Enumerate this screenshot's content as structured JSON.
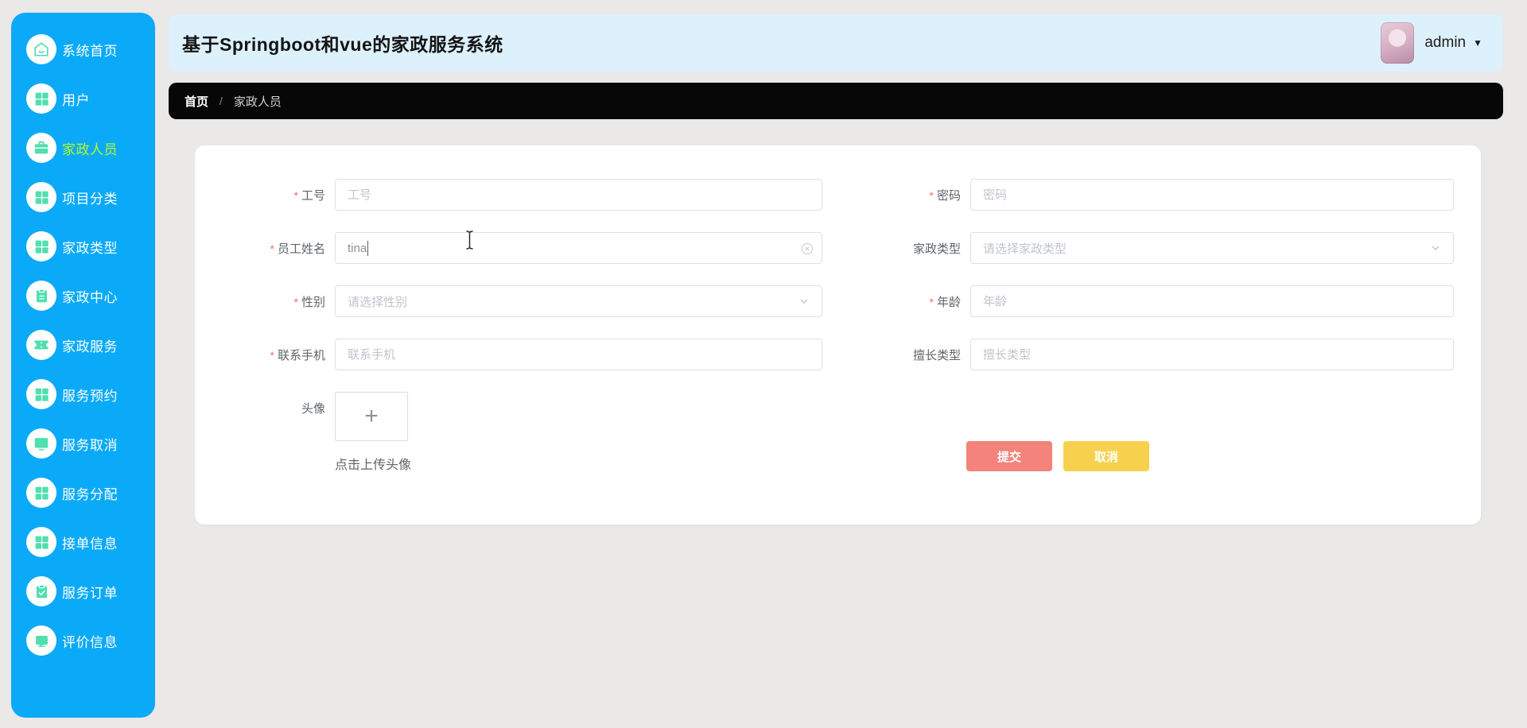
{
  "app": {
    "title": "基于Springboot和vue的家政服务系统",
    "user": "admin",
    "dropdown_caret": "▼"
  },
  "sidebar": {
    "items": [
      {
        "label": "系统首页",
        "icon": "home-icon",
        "active": false
      },
      {
        "label": "用户",
        "icon": "grid-icon",
        "active": false
      },
      {
        "label": "家政人员",
        "icon": "briefcase-icon",
        "active": true
      },
      {
        "label": "项目分类",
        "icon": "grid-icon",
        "active": false
      },
      {
        "label": "家政类型",
        "icon": "grid-icon",
        "active": false
      },
      {
        "label": "家政中心",
        "icon": "clipboard-icon",
        "active": false
      },
      {
        "label": "家政服务",
        "icon": "ticket-icon",
        "active": false
      },
      {
        "label": "服务预约",
        "icon": "grid-icon",
        "active": false
      },
      {
        "label": "服务取消",
        "icon": "monitor-icon",
        "active": false
      },
      {
        "label": "服务分配",
        "icon": "grid-icon",
        "active": false
      },
      {
        "label": "接单信息",
        "icon": "grid-icon",
        "active": false
      },
      {
        "label": "服务订单",
        "icon": "clipboard-check-icon",
        "active": false
      },
      {
        "label": "评价信息",
        "icon": "message-icon",
        "active": false
      }
    ]
  },
  "breadcrumb": {
    "home": "首页",
    "separator": "/",
    "current": "家政人员"
  },
  "form": {
    "required_mark": "*",
    "work_id": {
      "label": "工号",
      "placeholder": "工号"
    },
    "password": {
      "label": "密码",
      "placeholder": "密码"
    },
    "employee_name": {
      "label": "员工姓名",
      "value": "tina"
    },
    "housekeeping_type": {
      "label": "家政类型",
      "placeholder": "请选择家政类型"
    },
    "gender": {
      "label": "性别",
      "placeholder": "请选择性别"
    },
    "age": {
      "label": "年龄",
      "placeholder": "年龄"
    },
    "phone": {
      "label": "联系手机",
      "placeholder": "联系手机"
    },
    "specialty": {
      "label": "擅长类型",
      "placeholder": "擅长类型"
    },
    "avatar_upload": {
      "label": "头像",
      "plus": "+",
      "hint": "点击上传头像"
    },
    "actions": {
      "submit": "提交",
      "cancel": "取消"
    }
  },
  "colors": {
    "sidebar_bg": "#0aaaf8",
    "sidebar_icon": "#50dfae",
    "sidebar_active_text": "#b9f728",
    "header_bg": "#ddf1fd",
    "breadcrumb_bg": "#070707",
    "submit_btn": "#f3837b",
    "cancel_btn": "#f7d14e",
    "required_asterisk": "#f56c6c",
    "page_bg": "#ebe8e8"
  }
}
